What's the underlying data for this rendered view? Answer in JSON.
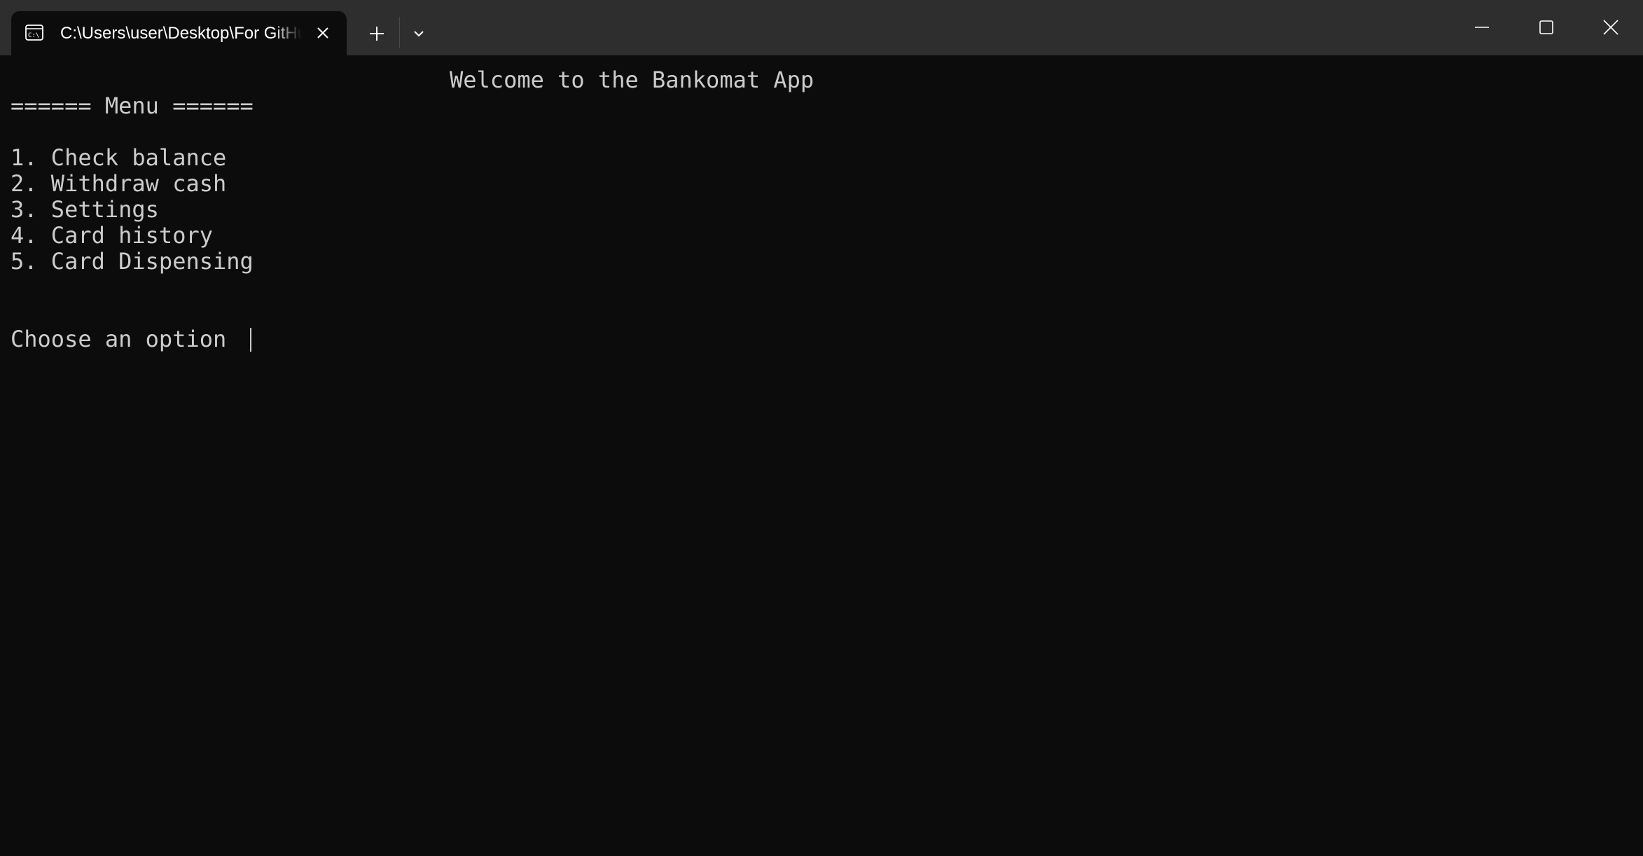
{
  "tab": {
    "title": "C:\\Users\\user\\Desktop\\For GitHub\\Bankomat.exe",
    "icon": "terminal-icon"
  },
  "window_controls": {
    "minimize_icon": "minimize-icon",
    "maximize_icon": "maximize-icon",
    "close_icon": "close-icon"
  },
  "console": {
    "welcome": "Welcome to the Bankomat App",
    "menu_header": "====== Menu ======",
    "menu_items": [
      "1. Check balance",
      "2. Withdraw cash",
      "3. Settings",
      "4. Card history",
      "5. Card Dispensing"
    ],
    "prompt": "Choose an option "
  },
  "colors": {
    "background": "#0c0c0c",
    "titlebar": "#2e2e2e",
    "text": "#cccccc"
  }
}
